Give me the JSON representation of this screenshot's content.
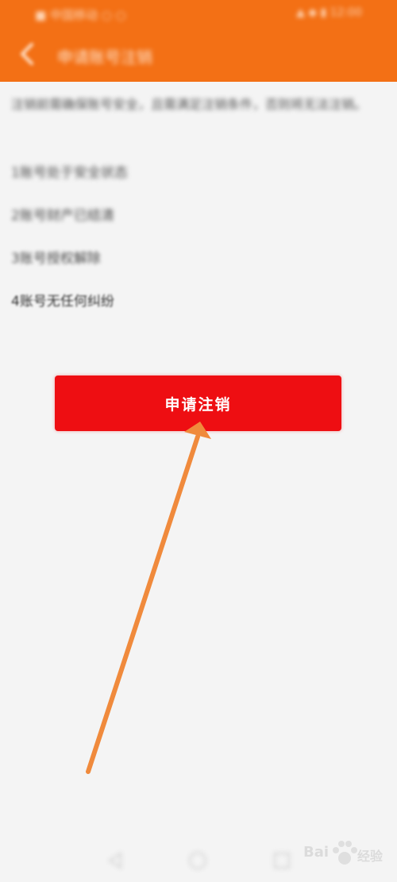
{
  "status_bar": {
    "left_text": "■ 中国移动 ○ ○",
    "right_text": "▲ ◆ ▮ 12:00"
  },
  "nav": {
    "title": "申请账号注销"
  },
  "intro": "注销前需确保账号安全，且需满足注销条件，否则将无法注销。",
  "conditions": [
    "1账号处于安全状态",
    "2账号财产已结清",
    "3账号授权解除",
    "4账号无任何纠纷"
  ],
  "primary_action": {
    "label": "申请注销"
  },
  "colors": {
    "header": "#f37015",
    "button": "#ee0e12",
    "arrow": "#f08a3c",
    "background": "#f4f4f4"
  },
  "icons": {
    "back": "back-arrow-icon",
    "nav_back": "triangle-back-icon",
    "nav_home": "circle-home-icon",
    "nav_recent": "square-recent-icon"
  },
  "watermark": {
    "brand": "Bai",
    "suffix": "经验"
  }
}
